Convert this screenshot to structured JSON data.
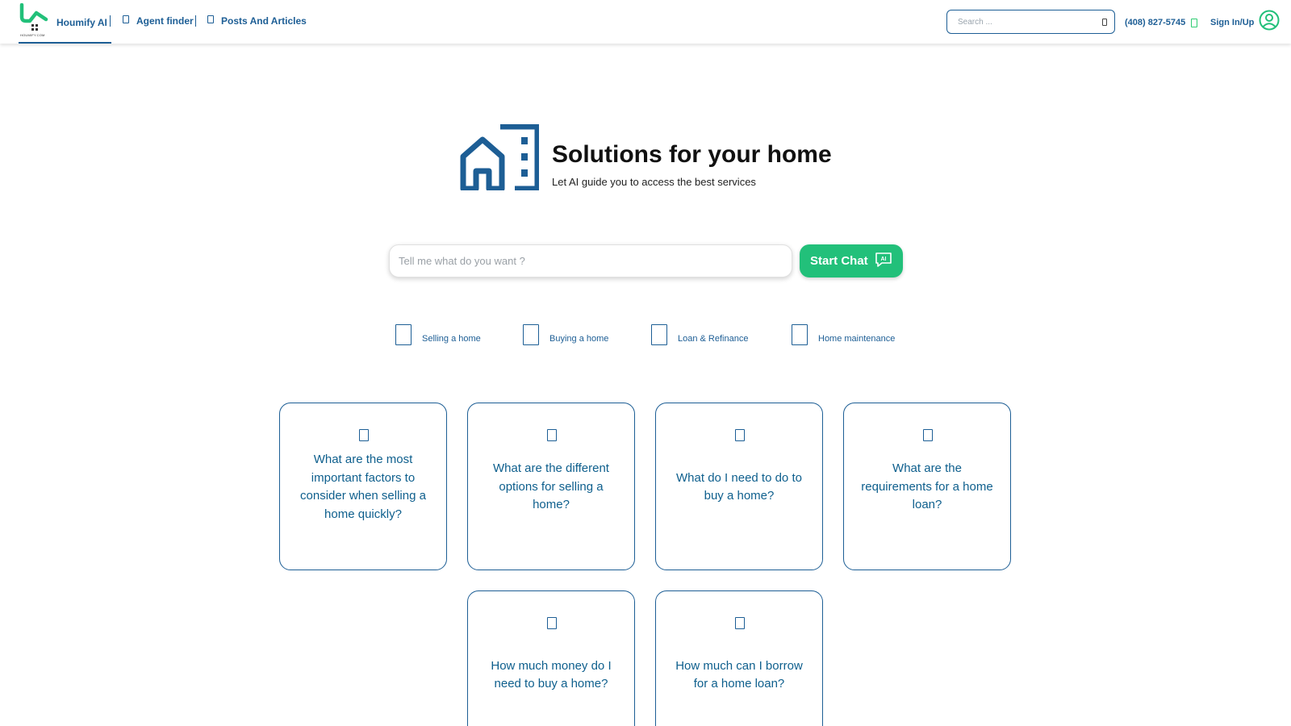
{
  "header": {
    "brand_label": "Houmify AI",
    "logo_caption": "HOUMIFY.COM",
    "nav": [
      {
        "label": "Agent finder"
      },
      {
        "label": "Posts And Articles"
      }
    ],
    "search_placeholder": "Search ...",
    "phone": "(408) 827-5745",
    "sign_in": "Sign In/Up"
  },
  "hero": {
    "title": "Solutions for your home",
    "subtitle": "Let AI guide you to access the best services"
  },
  "chat": {
    "placeholder": "Tell me what do you want ?",
    "button_label": "Start Chat",
    "ai_badge": "AI"
  },
  "categories": [
    {
      "label": "Selling a home"
    },
    {
      "label": "Buying a home"
    },
    {
      "label": "Loan & Refinance"
    },
    {
      "label": "Home maintenance"
    }
  ],
  "questions": [
    {
      "text": "What are the most important factors to consider when selling a home quickly?"
    },
    {
      "text": "What are the different options for selling a home?"
    },
    {
      "text": "What do I need to do to buy a home?"
    },
    {
      "text": "What are the requirements for a home loan?"
    },
    {
      "text": "How much money do I need to buy a home?"
    },
    {
      "text": "How much can I borrow for a home loan?"
    }
  ],
  "colors": {
    "primary": "#1d5e95",
    "accent_green": "#22c07a",
    "title_text": "#111111"
  },
  "icons": {
    "logo": "houmify-logo-icon",
    "hero": "building-icon",
    "user": "user-circle-icon",
    "ai": "ai-chat-icon"
  }
}
